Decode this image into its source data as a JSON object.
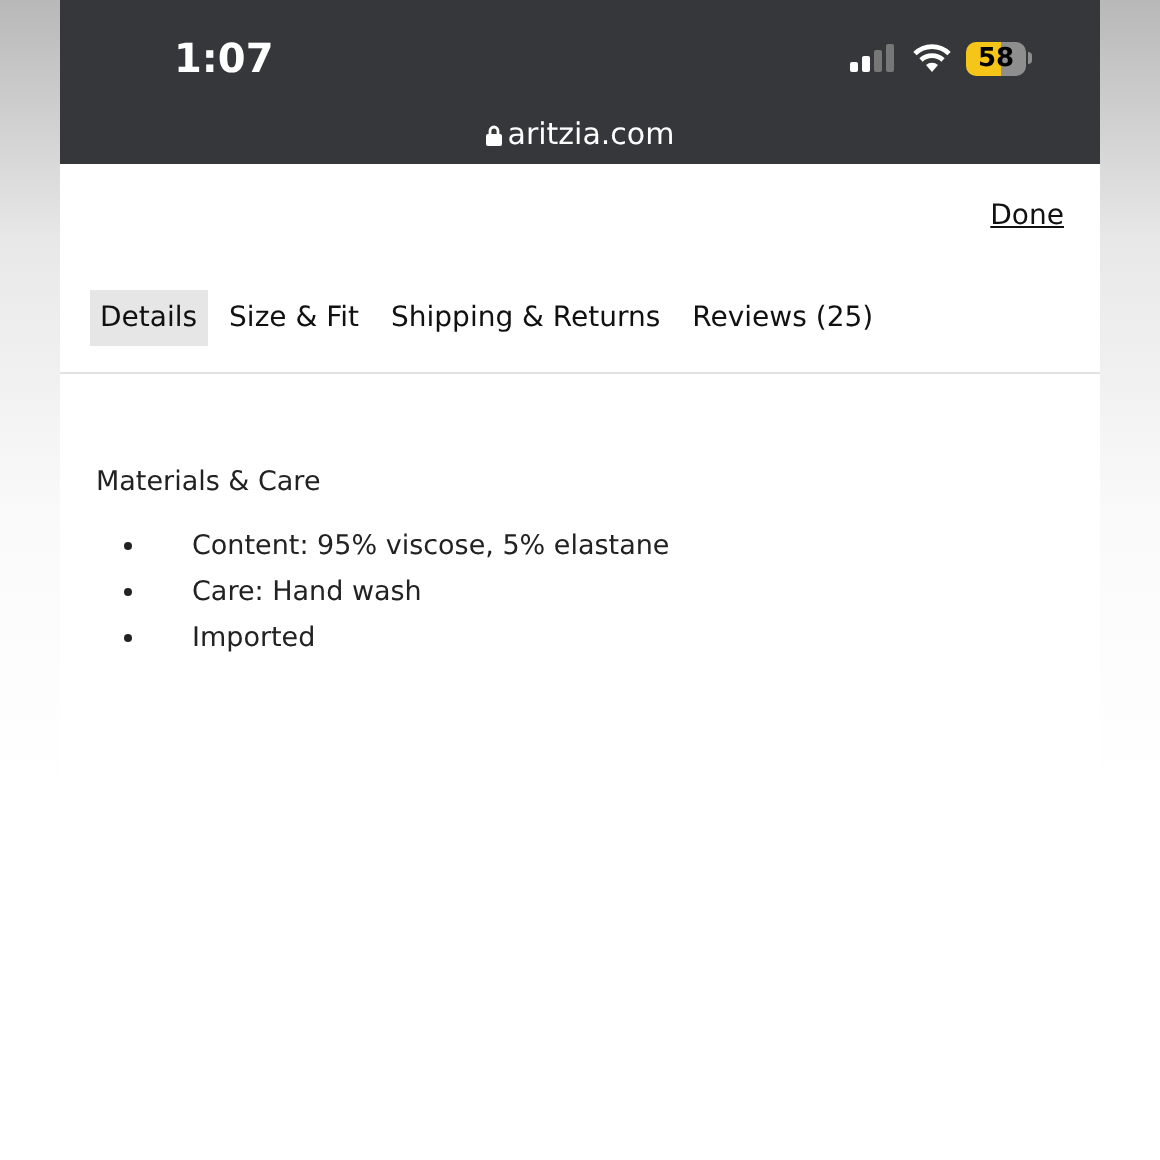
{
  "status_bar": {
    "time": "1:07",
    "battery": "58",
    "low_power": true
  },
  "address_bar": {
    "url": "aritzia.com"
  },
  "done_link": "Done",
  "tabs": [
    {
      "label": "Details",
      "selected": true
    },
    {
      "label": "Size & Fit",
      "selected": false
    },
    {
      "label": "Shipping & Returns",
      "selected": false
    },
    {
      "label": "Reviews (25)",
      "selected": false
    }
  ],
  "section": {
    "title": "Materials & Care",
    "items": [
      "Content: 95% viscose, 5% elastane",
      "Care: Hand wash",
      "Imported"
    ]
  }
}
